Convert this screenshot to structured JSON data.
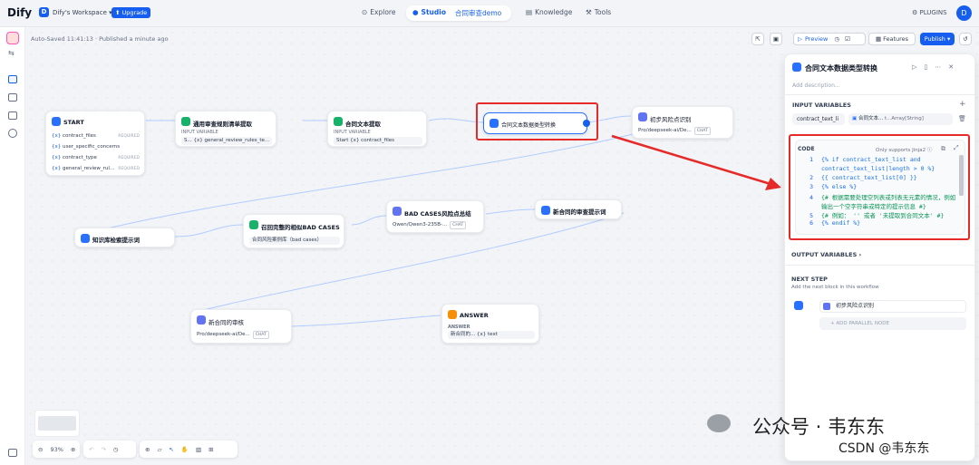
{
  "app": {
    "logo": "Dify",
    "workspace_initial": "D",
    "workspace_name": "Dify's Workspace ▾",
    "upgrade": "⬆ Upgrade",
    "plugins": "PLUGINS",
    "avatar": "D"
  },
  "nav": {
    "explore": "Explore",
    "studio": "Studio",
    "app_name": "合同审查demo",
    "knowledge": "Knowledge",
    "tools": "Tools"
  },
  "status": "Auto-Saved 11:41:13 · Published a minute ago",
  "toolbar": {
    "preview": "Preview",
    "features": "Features",
    "publish": "Publish ▾"
  },
  "nodes": {
    "start": {
      "title": "START",
      "vars": [
        {
          "name": "contract_files",
          "req": "REQUIRED"
        },
        {
          "name": "user_specific_concerns",
          "req": ""
        },
        {
          "name": "contract_type",
          "req": "REQUIRED"
        },
        {
          "name": "general_review_rul...",
          "req": "REQUIRED"
        }
      ]
    },
    "rules": {
      "title": "通用审查规则清单提取",
      "sub": "INPUT VARIABLE",
      "row": "S...  {x} general_review_rules_te..."
    },
    "extract": {
      "title": "合同文本提取",
      "sub": "INPUT VARIABLE",
      "row": "Start  {x} contract_files"
    },
    "convert": {
      "title": "合同文本数据类型转换"
    },
    "risk": {
      "title": "初步风险点识别",
      "model": "Pro/deepseek-ai/De...",
      "tag": "CHAT"
    },
    "kbprompt": {
      "title": "知识库检索提示词"
    },
    "badcases": {
      "title": "召回完整的相似BAD CASES",
      "row": "合同风险案例库（bad cases）"
    },
    "summary": {
      "title": "BAD CASES风险点总结",
      "model": "Qwen/Qwen3-235B-...",
      "tag": "CHAT"
    },
    "newprompt": {
      "title": "新合同的审查提示词"
    },
    "review": {
      "title": "新合同的审核",
      "model": "Pro/deepseek-ai/De...",
      "tag": "CHAT"
    },
    "answer": {
      "title": "ANSWER",
      "sub": "ANSWER",
      "row": "新合同的...  {x} text"
    }
  },
  "panel": {
    "title": "合同文本数据类型转换",
    "description": "Add description...",
    "input_vars_header": "INPUT VARIABLES",
    "input_var_name": "contract_text_li",
    "input_var_ref": "合同文本...",
    "input_var_type": "t...Array[String]",
    "code_header": "CODE",
    "code_lang": "Only supports Jinja2 ⓘ",
    "code": [
      {
        "n": "1",
        "t": "{% if contract_text_list and",
        "c": "kw"
      },
      {
        "n": "",
        "t": "contract_text_list|length > 0 %}",
        "c": ""
      },
      {
        "n": "2",
        "t": "{{ contract_text_list[0] }}",
        "c": ""
      },
      {
        "n": "3",
        "t": "{% else %}",
        "c": ""
      },
      {
        "n": "4",
        "t": "{# 根据需要处理空列表或列表无元素的情况，例如",
        "c": "cm"
      },
      {
        "n": "",
        "t": "输出一个空字符串或特定的提示信息 #}",
        "c": "cm"
      },
      {
        "n": "5",
        "t": "{# 例如： '' 或者 '未提取到合同文本' #}",
        "c": "cm"
      },
      {
        "n": "6",
        "t": "{% endif %}",
        "c": ""
      }
    ],
    "output_vars": "OUTPUT VARIABLES ›",
    "next_step": "NEXT STEP",
    "next_step_desc": "Add the next block in this workflow",
    "next_node": "初步风险点识别",
    "add_parallel": "+ ADD PARALLEL NODE"
  },
  "bottom": {
    "zoom": "93%"
  },
  "watermark": {
    "line1": "公众号 · 韦东东",
    "line2": "CSDN @韦东东"
  }
}
